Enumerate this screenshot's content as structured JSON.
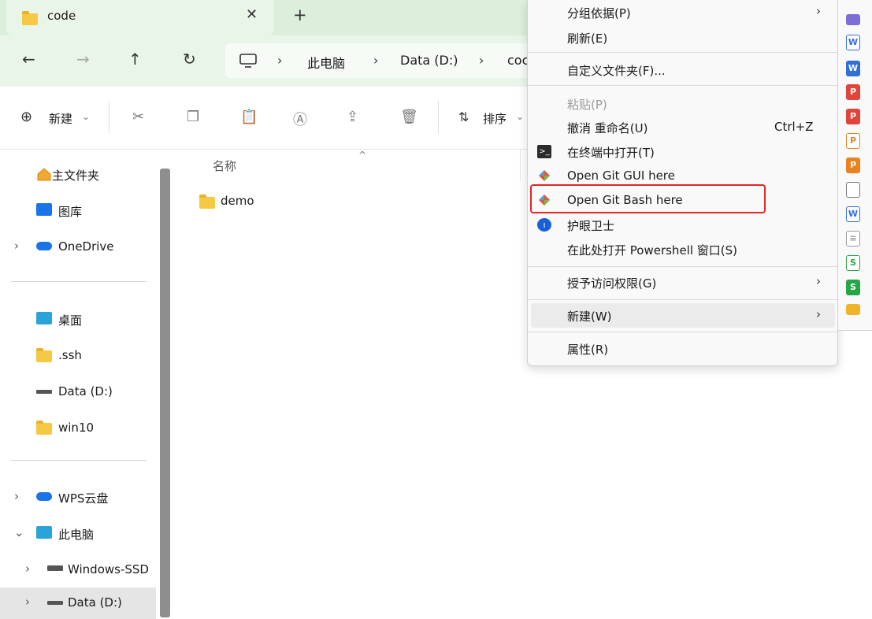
{
  "window": {
    "tab_title": "code",
    "tab_close": "✕",
    "new_tab": "+"
  },
  "nav": {
    "back": "←",
    "forward": "→",
    "up": "↑",
    "refresh": "↻"
  },
  "address": {
    "segments": [
      "此电脑",
      "Data (D:)",
      "coc"
    ]
  },
  "toolbar": {
    "new_label": "新建",
    "sort_label": "排序"
  },
  "sidebar": {
    "items": [
      {
        "label": "主文件夹",
        "icon": "home-icon"
      },
      {
        "label": "图库",
        "icon": "gallery-icon"
      },
      {
        "label": "OneDrive",
        "icon": "cloud-icon"
      },
      {
        "label": "桌面",
        "icon": "desktop-icon"
      },
      {
        "label": ".ssh",
        "icon": "folder-icon"
      },
      {
        "label": "Data (D:)",
        "icon": "drive-icon"
      },
      {
        "label": "win10",
        "icon": "folder-icon"
      },
      {
        "label": "WPS云盘",
        "icon": "cloud-icon"
      },
      {
        "label": "此电脑",
        "icon": "computer-icon"
      },
      {
        "label": "Windows-SSD",
        "icon": "drive-icon"
      },
      {
        "label": "Data (D:)",
        "icon": "drive-icon"
      }
    ]
  },
  "content": {
    "column_name": "名称",
    "sort_indicator": "^",
    "items": [
      {
        "label": "demo",
        "type": "folder"
      }
    ]
  },
  "context_menu": {
    "items": [
      {
        "label": "分组依据(P)",
        "submenu": true
      },
      {
        "label": "刷新(E)"
      },
      {
        "label": "自定义文件夹(F)..."
      },
      {
        "label": "粘贴(P)",
        "disabled": true
      },
      {
        "label": "撤消 重命名(U)",
        "shortcut": "Ctrl+Z"
      },
      {
        "label": "在终端中打开(T)",
        "icon": "terminal-icon"
      },
      {
        "label": "Open Git GUI here",
        "icon": "git-icon"
      },
      {
        "label": "Open Git Bash here",
        "icon": "git-icon",
        "highlighted_box": true
      },
      {
        "label": "护眼卫士",
        "icon": "shield-icon"
      },
      {
        "label": "在此处打开 Powershell 窗口(S)"
      },
      {
        "label": "授予访问权限(G)",
        "submenu": true
      },
      {
        "label": "新建(W)",
        "submenu": true,
        "hovered": true
      },
      {
        "label": "属性(R)"
      }
    ],
    "highlight_color": "#e32626"
  },
  "colors": {
    "titlebar_bg": "#dcefdc",
    "folder": "#f6c944",
    "accent_blue": "#1a73e8"
  }
}
